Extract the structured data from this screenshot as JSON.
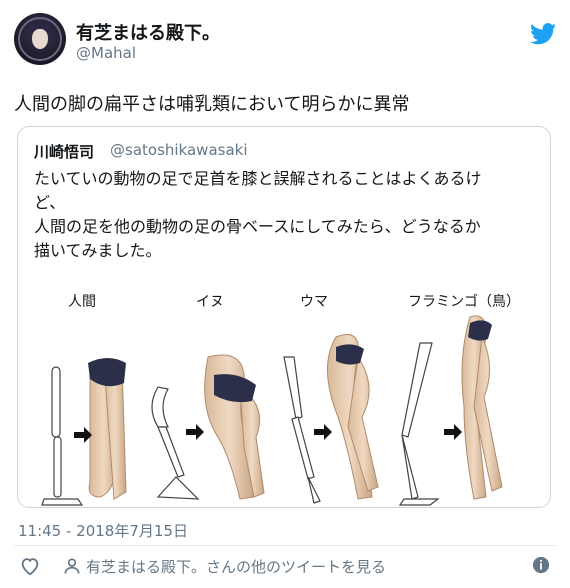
{
  "author": {
    "display_name": "有芝まはる殿下。",
    "handle": "@Mahal"
  },
  "tweet": {
    "text": "人間の脚の扁平さは哺乳類において明らかに異常",
    "timestamp": "11:45 - 2018年7月15日"
  },
  "quoted": {
    "display_name": "川崎悟司",
    "handle": "@satoshikawasaki",
    "lines": [
      "たいていの動物の足で足首を膝と誤解されることはよくあるけ",
      "ど、",
      "人間の足を他の動物の足の骨ベースにしてみたら、どうなるか",
      "描いてみました。"
    ],
    "figure_captions": [
      "人間",
      "イヌ",
      "ウマ",
      "フラミンゴ（鳥）"
    ]
  },
  "actions": {
    "more_tweets": "有芝まはる殿下。さんの他のツイートを見る"
  },
  "colors": {
    "twitter_blue": "#1da1f2",
    "secondary_text": "#657786",
    "border": "#ccd6dd"
  },
  "icons": [
    "twitter-bird-icon",
    "heart-icon",
    "person-icon",
    "info-icon",
    "arrow-right-icon"
  ]
}
